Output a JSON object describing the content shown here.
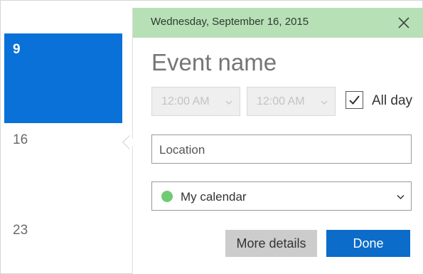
{
  "calendar_strip": {
    "selected_day": "9",
    "days": [
      "16",
      "23"
    ]
  },
  "flyout": {
    "header_date": "Wednesday, September 16, 2015",
    "event_name_placeholder": "Event name",
    "start_time": "12:00 AM",
    "end_time": "12:00 AM",
    "all_day_label": "All day",
    "all_day_checked": true,
    "location_placeholder": "Location",
    "calendar_name": "My calendar",
    "more_details_label": "More details",
    "done_label": "Done"
  },
  "colors": {
    "selected_day_bg": "#0a71d8",
    "header_bg": "#b7e0b7",
    "calendar_dot": "#6fcb72",
    "done_button": "#0b6cc9",
    "more_button": "#cccccc"
  },
  "icons": {
    "close": "close-icon",
    "chevron": "chevron-down-icon",
    "check": "checkmark-icon"
  }
}
